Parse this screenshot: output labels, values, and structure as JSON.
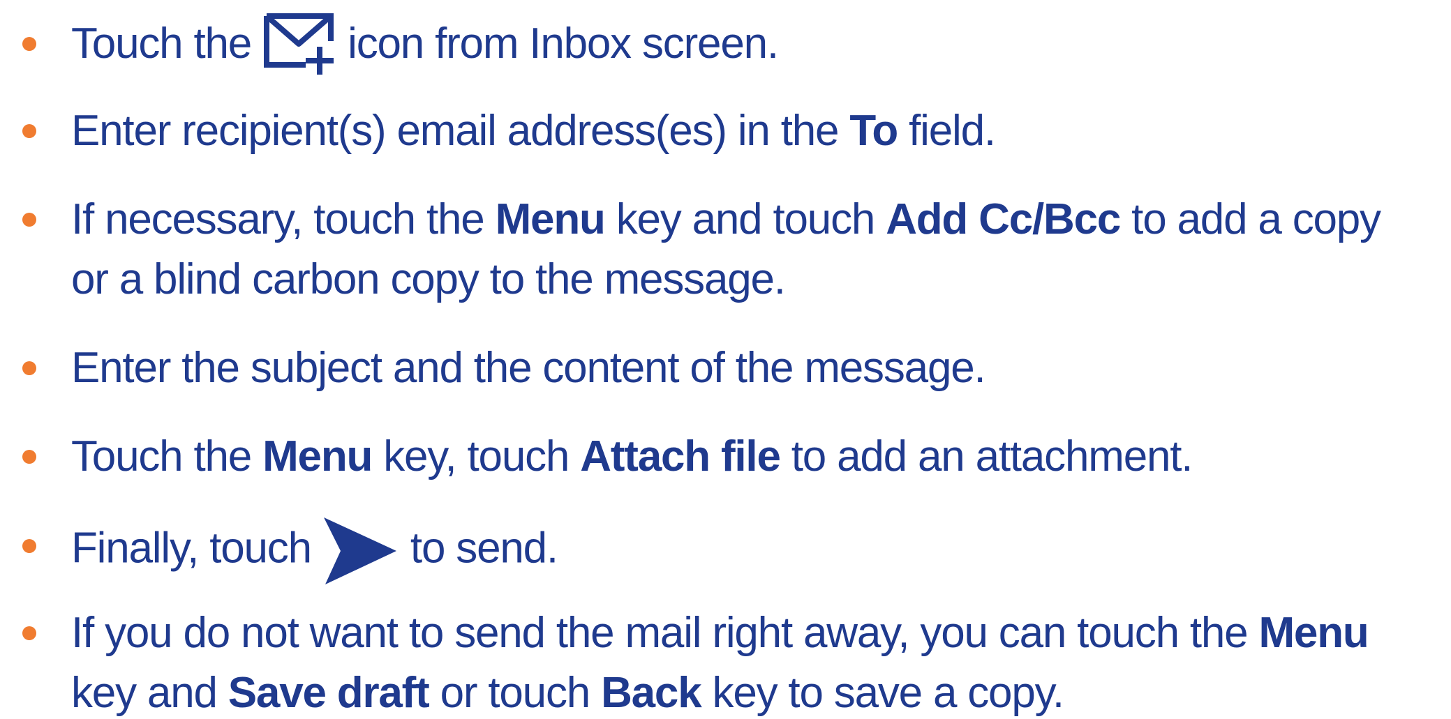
{
  "colors": {
    "text": "#1f3a8e",
    "bullet": "#f07c30"
  },
  "icons": {
    "compose": "compose-mail-icon",
    "send": "send-arrow-icon"
  },
  "steps": [
    {
      "before": "Touch the ",
      "after": " icon from Inbox screen."
    },
    {
      "t1": "Enter recipient(s) email address(es) in the ",
      "b1": "To",
      "t2": " field."
    },
    {
      "t1": "If necessary, touch the ",
      "b1": "Menu",
      "t2": " key and touch ",
      "b2": "Add Cc/Bcc",
      "t3": " to add a copy",
      "line2": "or a blind carbon copy to the message."
    },
    {
      "t1": "Enter the subject and the content of the message."
    },
    {
      "t1": "Touch the ",
      "b1": "Menu",
      "t2": " key, touch ",
      "b2": "Attach file",
      "t3": " to add an attachment."
    },
    {
      "before": "Finally, touch ",
      "after": " to send."
    },
    {
      "t1": "If you do not want to send the mail right away, you can touch the ",
      "b1": "Menu",
      "l2t1": "key and ",
      "l2b1": "Save draft",
      "l2t2": " or touch ",
      "l2b2": "Back",
      "l2t3": " key to save a copy."
    }
  ]
}
